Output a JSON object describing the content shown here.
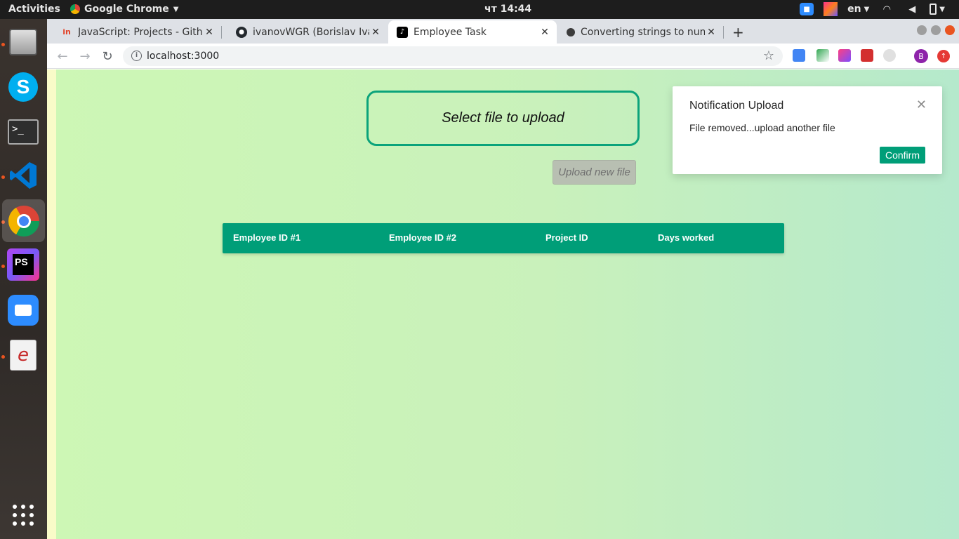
{
  "topbar": {
    "activities": "Activities",
    "app_name": "Google Chrome",
    "clock": "чт 14:44",
    "language": "en"
  },
  "dock": {
    "apps": [
      "files-icon",
      "skype-icon",
      "terminal-icon",
      "vscode-icon",
      "chrome-icon",
      "phpstorm-icon",
      "zoom-icon",
      "document-viewer-icon",
      "app-grid-icon"
    ]
  },
  "browser": {
    "tabs": [
      {
        "title": "JavaScript: Projects - Gith",
        "icon": "gitlab-icon"
      },
      {
        "title": "ivanovWGR (Borislav Ivan",
        "icon": "github-icon"
      },
      {
        "title": "Employee Task",
        "icon": "tiktok-icon"
      },
      {
        "title": "Converting strings to num",
        "icon": "page-icon"
      }
    ],
    "url": "localhost:3000",
    "profile_initial": "B"
  },
  "page": {
    "upload_prompt": "Select file to upload",
    "upload_button": "Upload new file",
    "table_headers": [
      "Employee ID #1",
      "Employee ID #2",
      "Project ID",
      "Days worked"
    ]
  },
  "notification": {
    "title": "Notification Upload",
    "message": "File removed...upload another file",
    "confirm_label": "Confirm"
  },
  "colors": {
    "accent": "#009e78",
    "upload_border": "#0ba37b",
    "ubuntu_orange": "#e95420"
  }
}
